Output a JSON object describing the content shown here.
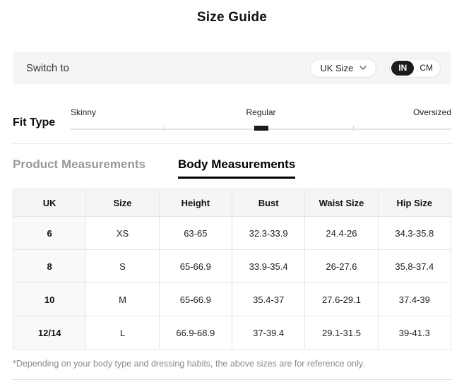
{
  "title": "Size Guide",
  "switch_bar": {
    "label": "Switch to",
    "size_dropdown": {
      "value": "UK Size"
    },
    "unit_toggle": {
      "options": [
        "IN",
        "CM"
      ],
      "selected": "IN"
    }
  },
  "fit_type": {
    "label": "Fit Type",
    "options": [
      "Skinny",
      "Regular",
      "Oversized"
    ],
    "selected": "Regular"
  },
  "tabs": [
    {
      "label": "Product Measurements",
      "active": false
    },
    {
      "label": "Body Measurements",
      "active": true
    }
  ],
  "table": {
    "headers": [
      "UK",
      "Size",
      "Height",
      "Bust",
      "Waist Size",
      "Hip Size"
    ],
    "rows": [
      [
        "6",
        "XS",
        "63-65",
        "32.3-33.9",
        "24.4-26",
        "34.3-35.8"
      ],
      [
        "8",
        "S",
        "65-66.9",
        "33.9-35.4",
        "26-27.6",
        "35.8-37.4"
      ],
      [
        "10",
        "M",
        "65-66.9",
        "35.4-37",
        "27.6-29.1",
        "37.4-39"
      ],
      [
        "12/14",
        "L",
        "66.9-68.9",
        "37-39.4",
        "29.1-31.5",
        "39-41.3"
      ]
    ]
  },
  "footnote": "*Depending on your body type and dressing habits, the above sizes are for reference only.",
  "colors": {
    "accent": "#1a1a1a",
    "bar_background": "#f5f5f5",
    "table_border": "#e5e5e5",
    "inactive_text": "#999999"
  }
}
